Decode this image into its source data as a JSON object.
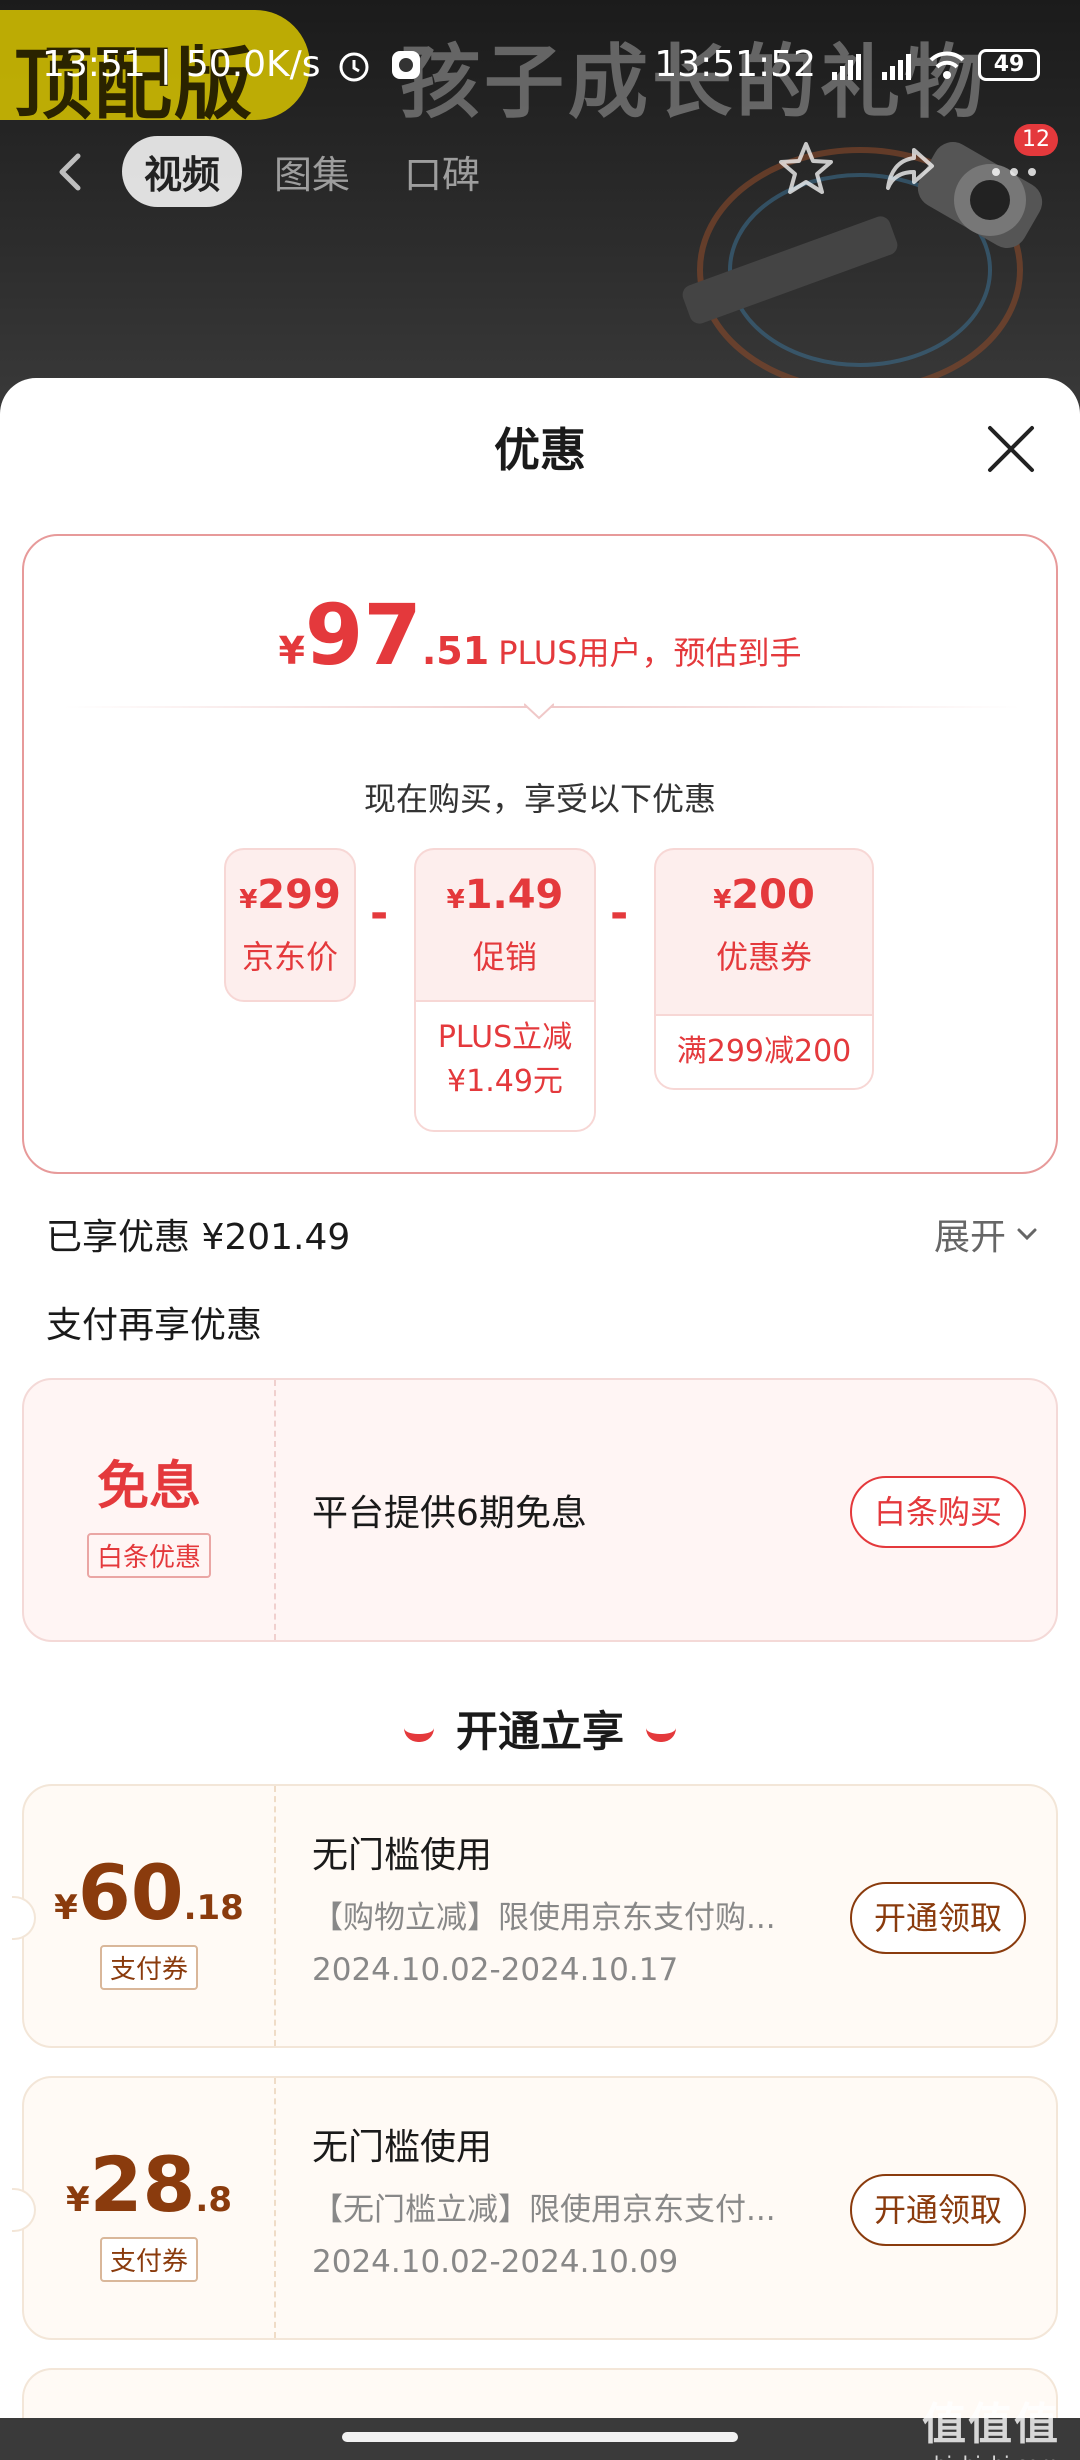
{
  "status_bar": {
    "time": "13:51",
    "speed": "50.0K/s",
    "clock": "13:51:52",
    "battery": "49"
  },
  "banner": {
    "badge_text": "顶配版",
    "promo_text": "孩子成长的礼物"
  },
  "nav": {
    "tabs": [
      {
        "label": "视频",
        "active": true
      },
      {
        "label": "图集",
        "active": false
      },
      {
        "label": "口碑",
        "active": false
      }
    ],
    "notification_count": "12"
  },
  "sheet": {
    "title": "优惠"
  },
  "estimate": {
    "currency": "¥",
    "integer": "97",
    "decimal": ".51",
    "label": "PLUS用户，预估到手"
  },
  "buy_now": "现在购买，享受以下优惠",
  "calc": [
    {
      "currency": "¥",
      "amount": "299",
      "label": "京东价",
      "sub": ""
    },
    {
      "currency": "¥",
      "amount": "1.49",
      "label": "促销",
      "sub": "PLUS立减\n¥1.49元"
    },
    {
      "currency": "¥",
      "amount": "200",
      "label": "优惠券",
      "sub": "满299减200"
    }
  ],
  "calc_minus": "-",
  "enjoyed": "已享优惠 ¥201.49",
  "expand": "展开",
  "payment": {
    "section_title": "支付再享优惠",
    "big": "免息",
    "tag": "白条优惠",
    "desc": "平台提供6期免息",
    "button": "白条购买"
  },
  "open_title": "开通立享",
  "coupons": [
    {
      "currency": "¥",
      "integer": "60",
      "decimal": ".18",
      "tag": "支付券",
      "title": "无门槛使用",
      "desc": "【购物立减】限使用京东支付购...",
      "date": "2024.10.02-2024.10.17",
      "button": "开通领取"
    },
    {
      "currency": "¥",
      "integer": "28",
      "decimal": ".8",
      "tag": "支付券",
      "title": "无门槛使用",
      "desc": "【无门槛立减】限使用京东支付...",
      "date": "2024.10.02-2024.10.09",
      "button": "开通领取"
    }
  ],
  "watermark": {
    "line1": "值值值",
    "line2": "zhizhizhi.com"
  },
  "colors": {
    "accent": "#e4393c",
    "coupon_brown": "#8a3b0d"
  }
}
